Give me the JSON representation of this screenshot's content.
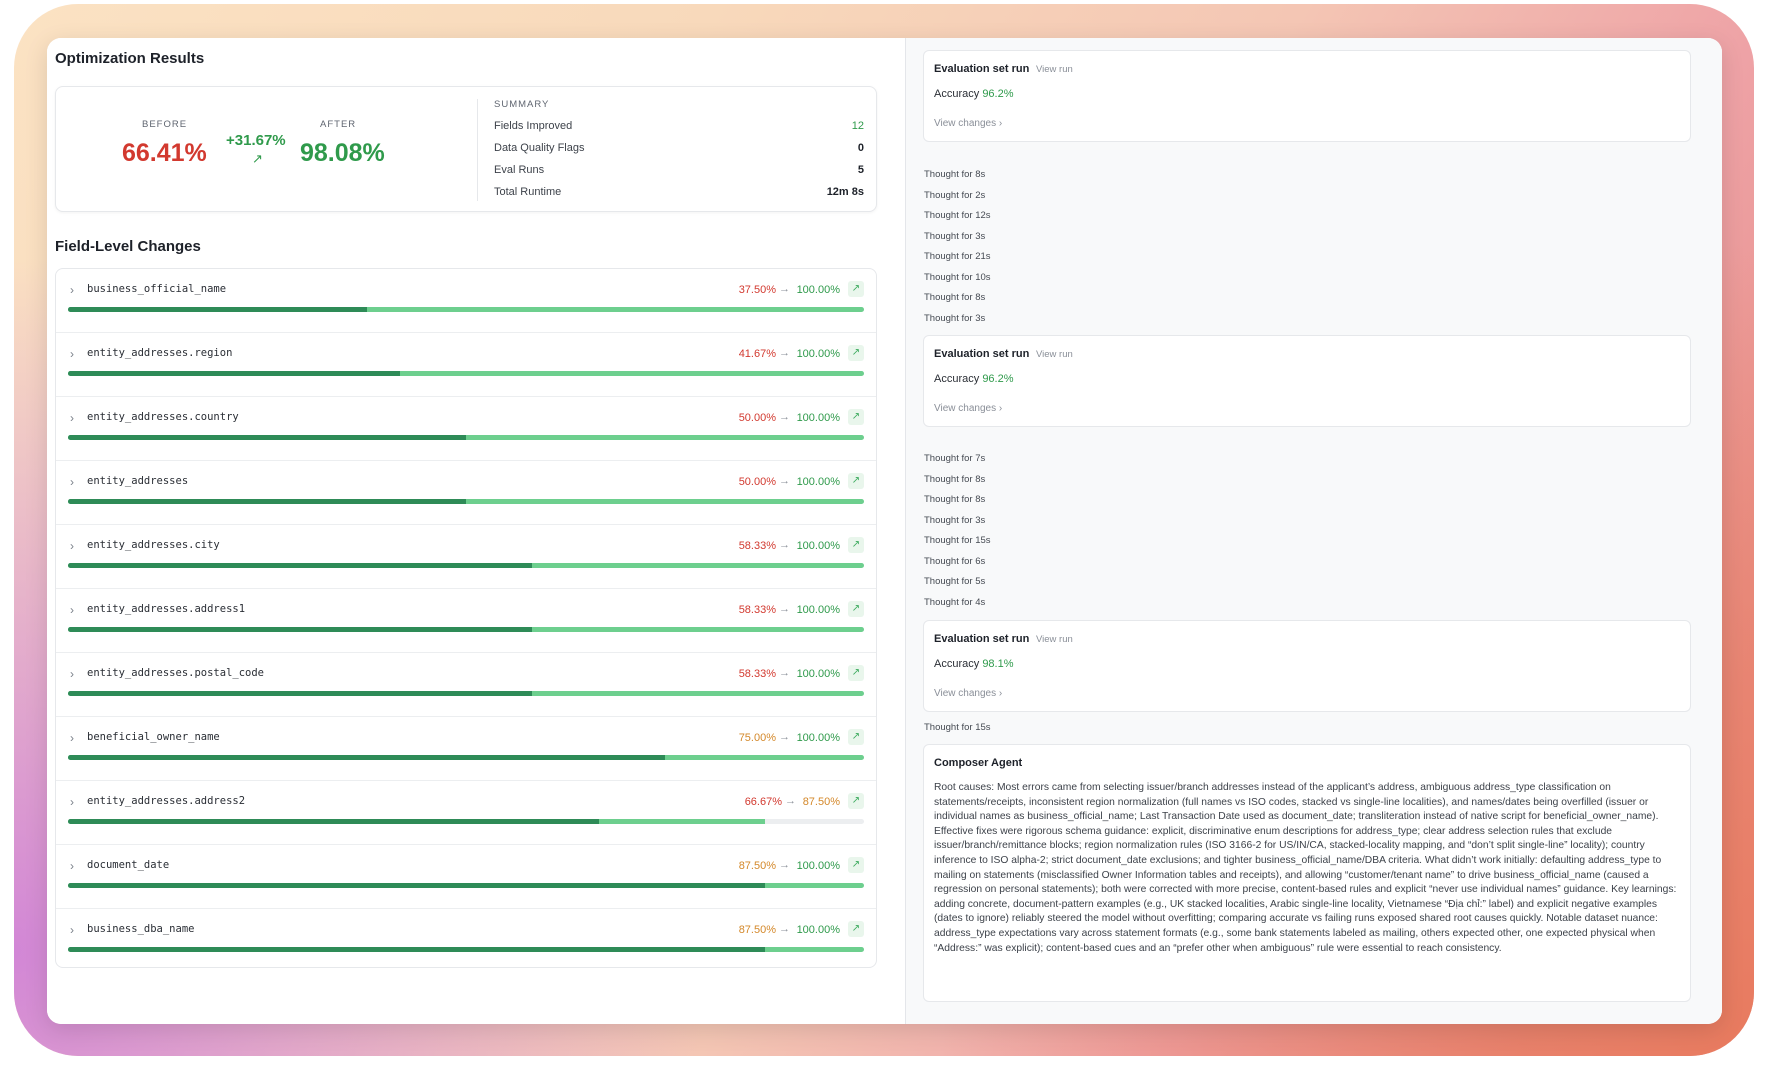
{
  "left": {
    "title": "Optimization Results",
    "before_label": "BEFORE",
    "before_value": "66.41%",
    "delta": "+31.67%",
    "after_label": "AFTER",
    "after_value": "98.08%",
    "summary": {
      "title": "SUMMARY",
      "rows": [
        {
          "label": "Fields Improved",
          "value": "12"
        },
        {
          "label": "Data Quality Flags",
          "value": "0"
        },
        {
          "label": "Eval Runs",
          "value": "5"
        },
        {
          "label": "Total Runtime",
          "value": "12m 8s"
        }
      ]
    },
    "fields_title": "Field-Level Changes",
    "fields": [
      {
        "name": "business_official_name",
        "before": "37.50%",
        "after": "100.00%",
        "before_frac": 0.375,
        "after_frac": 1.0,
        "before_color": "red"
      },
      {
        "name": "entity_addresses.region",
        "before": "41.67%",
        "after": "100.00%",
        "before_frac": 0.4167,
        "after_frac": 1.0,
        "before_color": "red"
      },
      {
        "name": "entity_addresses.country",
        "before": "50.00%",
        "after": "100.00%",
        "before_frac": 0.5,
        "after_frac": 1.0,
        "before_color": "red"
      },
      {
        "name": "entity_addresses",
        "before": "50.00%",
        "after": "100.00%",
        "before_frac": 0.5,
        "after_frac": 1.0,
        "before_color": "red"
      },
      {
        "name": "entity_addresses.city",
        "before": "58.33%",
        "after": "100.00%",
        "before_frac": 0.5833,
        "after_frac": 1.0,
        "before_color": "red"
      },
      {
        "name": "entity_addresses.address1",
        "before": "58.33%",
        "after": "100.00%",
        "before_frac": 0.5833,
        "after_frac": 1.0,
        "before_color": "red"
      },
      {
        "name": "entity_addresses.postal_code",
        "before": "58.33%",
        "after": "100.00%",
        "before_frac": 0.5833,
        "after_frac": 1.0,
        "before_color": "red"
      },
      {
        "name": "beneficial_owner_name",
        "before": "75.00%",
        "after": "100.00%",
        "before_frac": 0.75,
        "after_frac": 1.0,
        "before_color": "orange"
      },
      {
        "name": "entity_addresses.address2",
        "before": "66.67%",
        "after": "87.50%",
        "before_frac": 0.6667,
        "after_frac": 0.875,
        "before_color": "red",
        "after_color": "orange"
      },
      {
        "name": "document_date",
        "before": "87.50%",
        "after": "100.00%",
        "before_frac": 0.875,
        "after_frac": 1.0,
        "before_color": "orange"
      },
      {
        "name": "business_dba_name",
        "before": "87.50%",
        "after": "100.00%",
        "before_frac": 0.875,
        "after_frac": 1.0,
        "before_color": "orange"
      }
    ]
  },
  "right": {
    "evals": [
      {
        "title": "Evaluation set run",
        "view_run": "View run",
        "acc_label": "Accuracy",
        "acc_value": "96.2%",
        "view_changes": "View changes  ›"
      },
      {
        "title": "Evaluation set run",
        "view_run": "View run",
        "acc_label": "Accuracy",
        "acc_value": "96.2%",
        "view_changes": "View changes  ›"
      },
      {
        "title": "Evaluation set run",
        "view_run": "View run",
        "acc_label": "Accuracy",
        "acc_value": "98.1%",
        "view_changes": "View changes  ›"
      }
    ],
    "thoughts_a": [
      "Thought for 8s",
      "Thought for 2s",
      "Thought for 12s",
      "Thought for 3s",
      "Thought for 21s",
      "Thought for 10s",
      "Thought for 8s",
      "Thought for 3s"
    ],
    "thoughts_b": [
      "Thought for 7s",
      "Thought for 8s",
      "Thought for 8s",
      "Thought for 3s",
      "Thought for 15s",
      "Thought for 6s",
      "Thought for 5s",
      "Thought for 4s"
    ],
    "thoughts_c": [
      "Thought for 15s"
    ],
    "composer": {
      "title": "Composer Agent",
      "body": "Root causes: Most errors came from selecting issuer/branch addresses instead of the applicant’s address, ambiguous address_type classification on statements/receipts, inconsistent region normalization (full names vs ISO codes, stacked vs single-line localities), and names/dates being overfilled (issuer or individual names as business_official_name; Last Transaction Date used as document_date; transliteration instead of native script for beneficial_owner_name). Effective fixes were rigorous schema guidance: explicit, discriminative enum descriptions for address_type; clear address selection rules that exclude issuer/branch/remittance blocks; region normalization rules (ISO 3166-2 for US/IN/CA, stacked-locality mapping, and “don’t split single-line” locality); country inference to ISO alpha-2; strict document_date exclusions; and tighter business_official_name/DBA criteria. What didn’t work initially: defaulting address_type to mailing on statements (misclassified Owner Information tables and receipts), and allowing “customer/tenant name” to drive business_official_name (caused a regression on personal statements); both were corrected with more precise, content-based rules and explicit “never use individual names” guidance. Key learnings: adding concrete, document-pattern examples (e.g., UK stacked localities, Arabic single-line locality, Vietnamese “Địa chỉ:” label) and explicit negative examples (dates to ignore) reliably steered the model without overfitting; comparing accurate vs failing runs exposed shared root causes quickly. Notable dataset nuance: address_type expectations vary across statement formats (e.g., some bank statements labeled as mailing, others expected other, one expected physical when “Address:” was explicit); content-based cues and an “prefer other when ambiguous” rule were essential to reach consistency."
    }
  }
}
